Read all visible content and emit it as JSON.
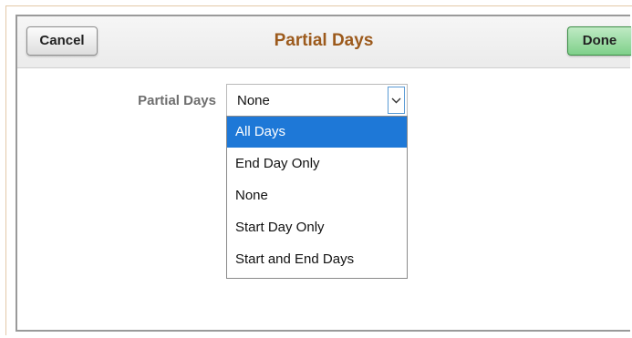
{
  "dialog": {
    "title": "Partial Days",
    "cancel_label": "Cancel",
    "done_label": "Done"
  },
  "field": {
    "label": "Partial Days",
    "selected_value": "None",
    "options": [
      {
        "label": "All Days",
        "highlighted": true
      },
      {
        "label": "End Day Only",
        "highlighted": false
      },
      {
        "label": "None",
        "highlighted": false
      },
      {
        "label": "Start Day Only",
        "highlighted": false
      },
      {
        "label": "Start and End Days",
        "highlighted": false
      }
    ]
  },
  "icons": {
    "dropdown": "chevron-down-icon"
  },
  "colors": {
    "title": "#9c5a1c",
    "done_button": "#7fd08a",
    "highlight": "#1e78d7"
  }
}
